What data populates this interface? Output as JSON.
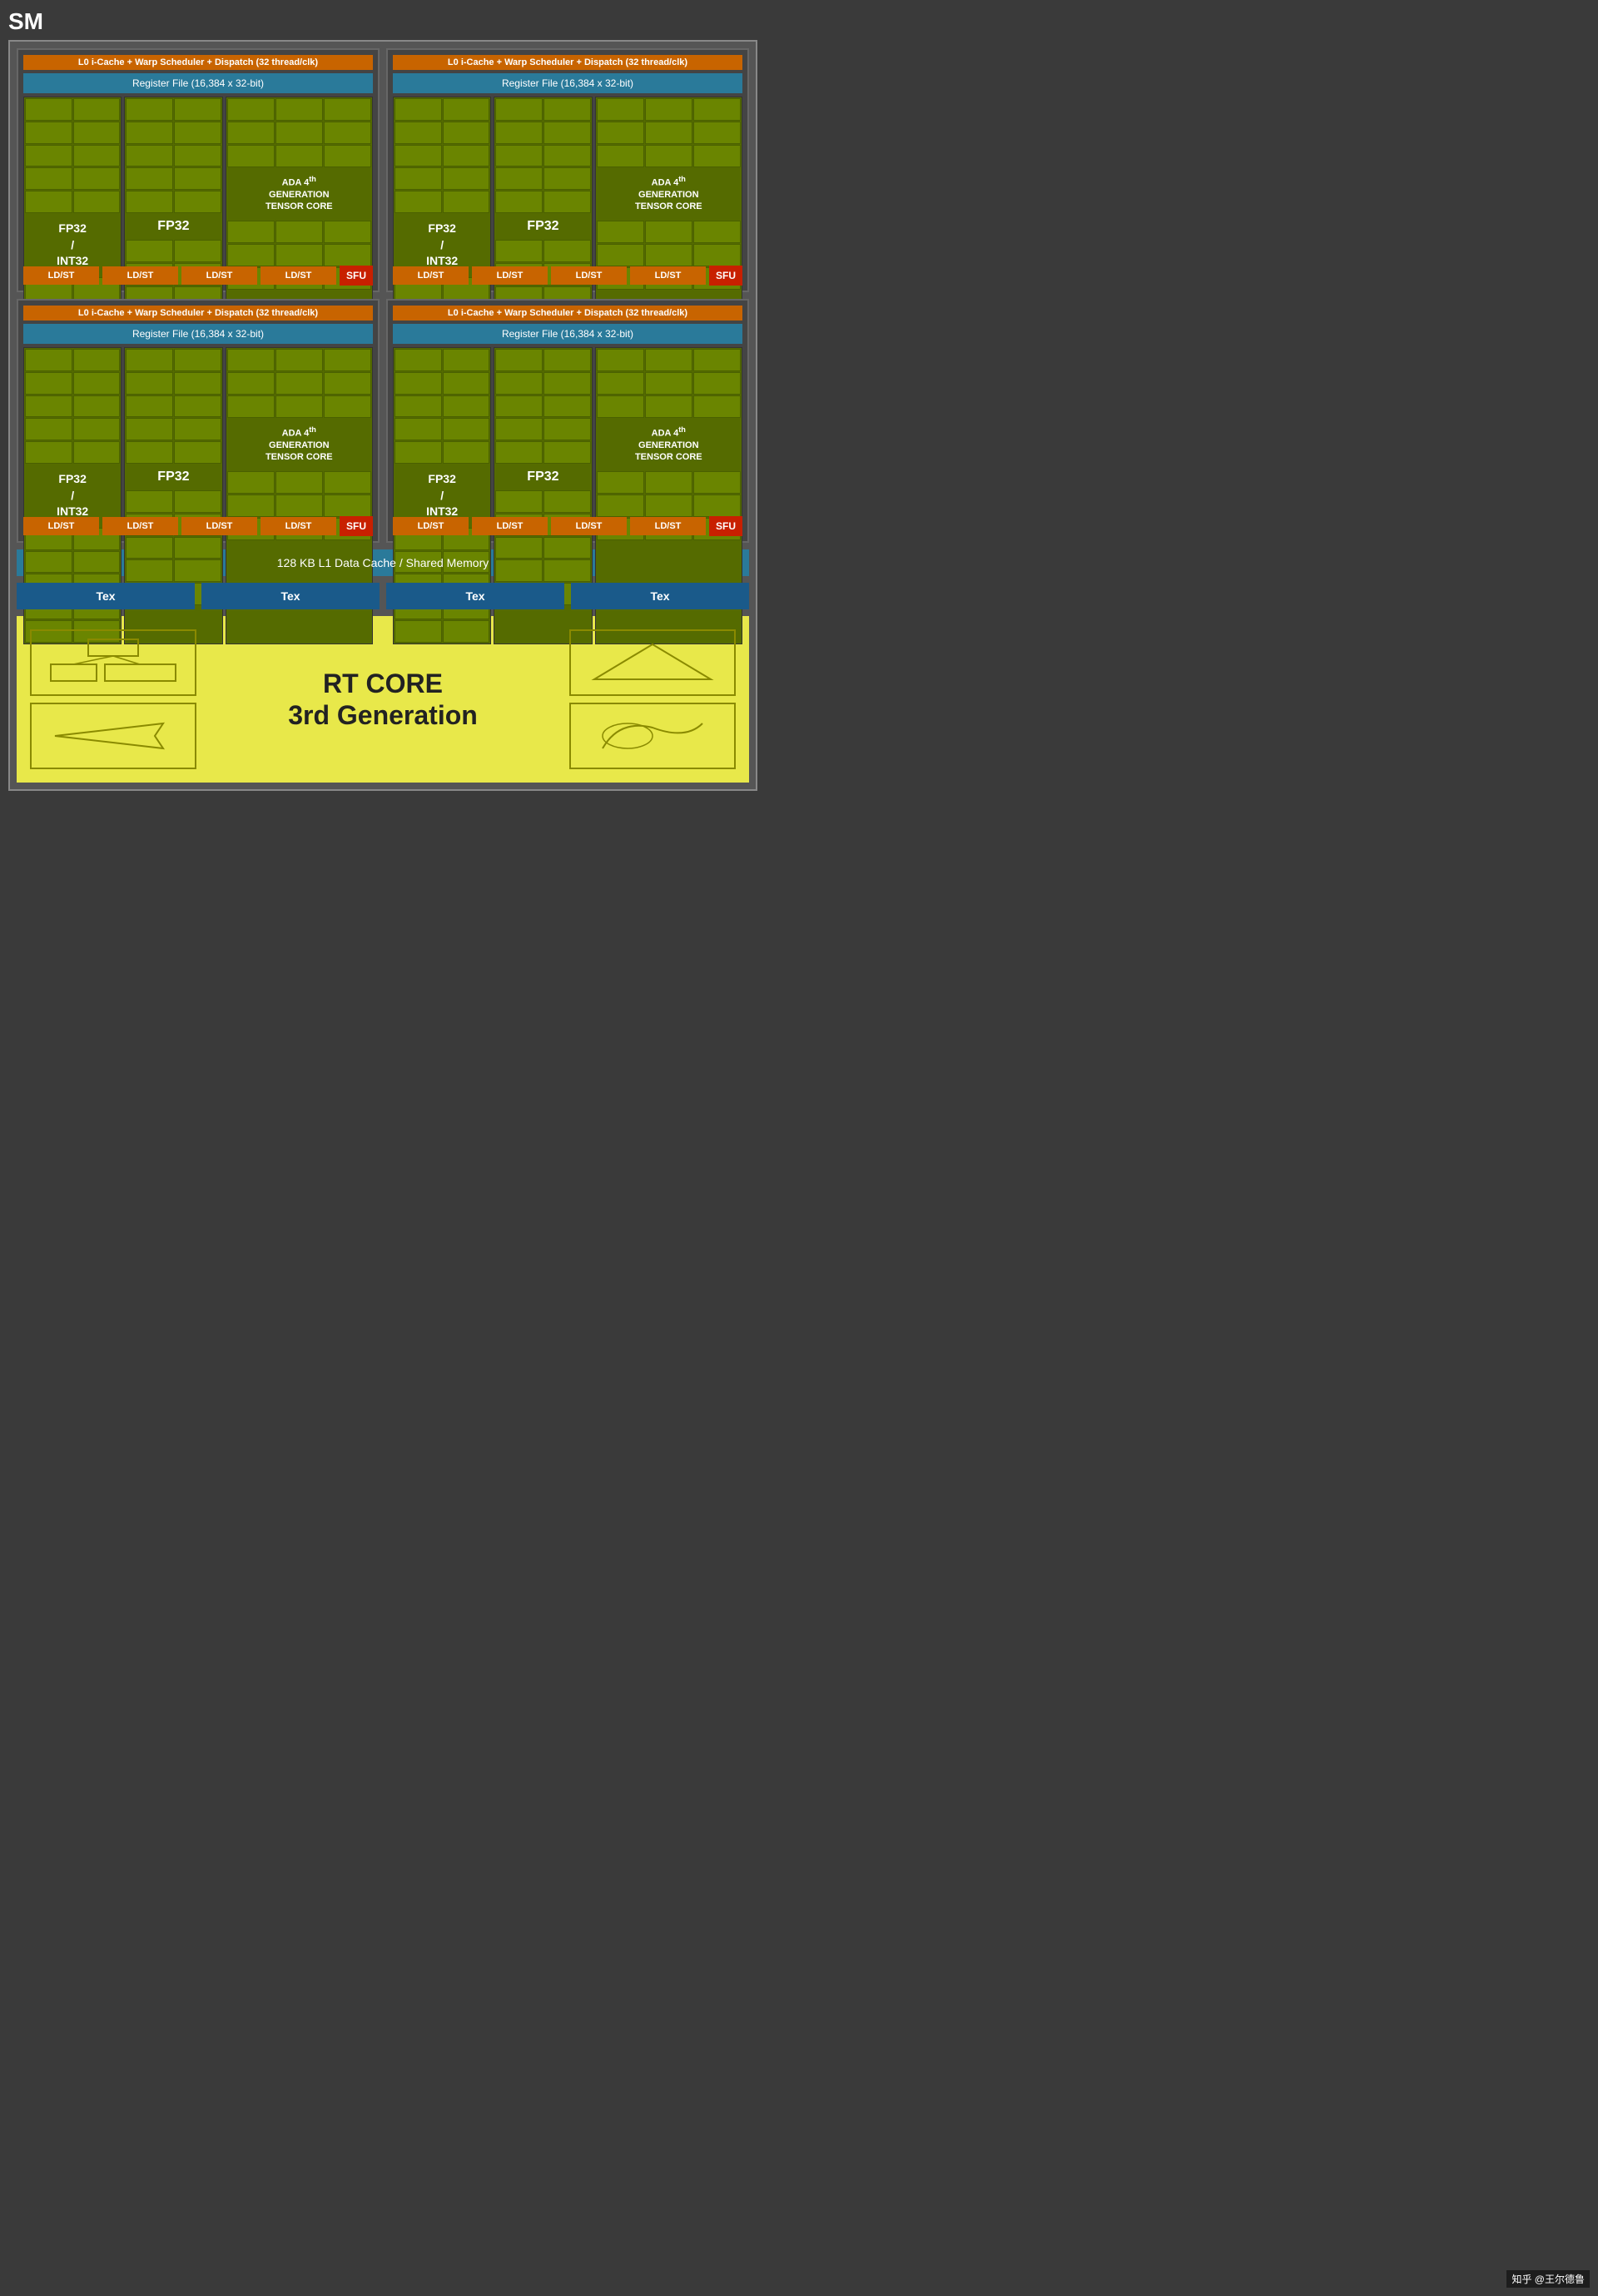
{
  "sm_label": "SM",
  "quadrants": [
    {
      "warp_scheduler": "L0 i-Cache + Warp Scheduler + Dispatch (32 thread/clk)",
      "register_file": "Register File (16,384 x 32-bit)",
      "fp32_int32_label": "FP32\n/\nINT32",
      "fp32_label": "FP32",
      "tensor_label": "ADA 4th GENERATION TENSOR CORE",
      "ldst_labels": [
        "LD/ST",
        "LD/ST",
        "LD/ST",
        "LD/ST"
      ],
      "sfu_label": "SFU"
    },
    {
      "warp_scheduler": "L0 i-Cache + Warp Scheduler + Dispatch (32 thread/clk)",
      "register_file": "Register File (16,384 x 32-bit)",
      "fp32_int32_label": "FP32\n/\nINT32",
      "fp32_label": "FP32",
      "tensor_label": "ADA 4th GENERATION TENSOR CORE",
      "ldst_labels": [
        "LD/ST",
        "LD/ST",
        "LD/ST",
        "LD/ST"
      ],
      "sfu_label": "SFU"
    },
    {
      "warp_scheduler": "L0 i-Cache + Warp Scheduler + Dispatch (32 thread/clk)",
      "register_file": "Register File (16,384 x 32-bit)",
      "fp32_int32_label": "FP32\n/\nINT32",
      "fp32_label": "FP32",
      "tensor_label": "ADA 4th GENERATION TENSOR CORE",
      "ldst_labels": [
        "LD/ST",
        "LD/ST",
        "LD/ST",
        "LD/ST"
      ],
      "sfu_label": "SFU"
    },
    {
      "warp_scheduler": "L0 i-Cache + Warp Scheduler + Dispatch (32 thread/clk)",
      "register_file": "Register File (16,384 x 32-bit)",
      "fp32_int32_label": "FP32\n/\nINT32",
      "fp32_label": "FP32",
      "tensor_label": "ADA 4th GENERATION TENSOR CORE",
      "ldst_labels": [
        "LD/ST",
        "LD/ST",
        "LD/ST",
        "LD/ST"
      ],
      "sfu_label": "SFU"
    }
  ],
  "l1_cache_label": "128 KB L1 Data Cache / Shared Memory",
  "tex_labels": [
    "Tex",
    "Tex",
    "Tex",
    "Tex"
  ],
  "rt_core_title": "RT CORE",
  "rt_core_subtitle": "3rd Generation",
  "watermark": "知乎 @王尔德鲁"
}
